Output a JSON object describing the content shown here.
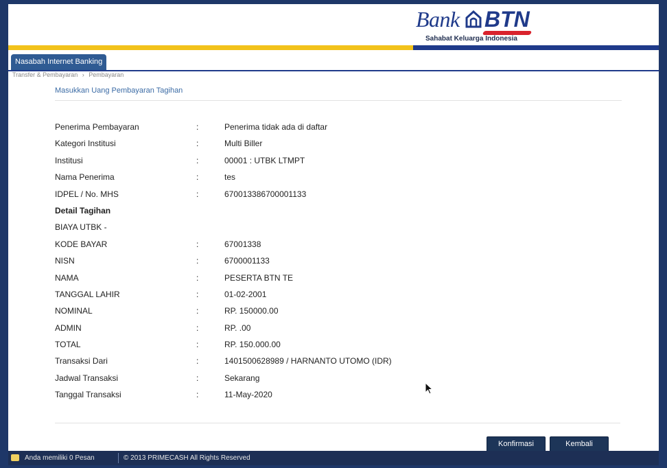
{
  "header": {
    "logo_bank": "Bank",
    "logo_btn": "BTN",
    "tagline": "Sahabat Keluarga Indonesia",
    "colors": {
      "brand_blue": "#1f3a8a",
      "accent_yellow": "#f2c21b",
      "accent_red": "#d9232d"
    }
  },
  "tabs": [
    {
      "label": "Nasabah Internet Banking"
    }
  ],
  "breadcrumb": [
    "Transfer & Pembayaran",
    "Pembayaran"
  ],
  "section_title": "Masukkan Uang Pembayaran Tagihan",
  "rows": [
    {
      "label": "Penerima Pembayaran",
      "colon": ":",
      "value": "Penerima tidak ada di daftar"
    },
    {
      "label": "Kategori Institusi",
      "colon": ":",
      "value": "Multi Biller"
    },
    {
      "label": "Institusi",
      "colon": ":",
      "value": "00001 : UTBK LTMPT"
    },
    {
      "label": "Nama Penerima",
      "colon": ":",
      "value": "tes"
    },
    {
      "label": "IDPEL / No. MHS",
      "colon": ":",
      "value": "670013386700001133"
    },
    {
      "label": "Detail Tagihan",
      "colon": "",
      "value": ""
    },
    {
      "label": "BIAYA UTBK -",
      "colon": "",
      "value": ""
    },
    {
      "label": "KODE BAYAR",
      "colon": ":",
      "value": "67001338"
    },
    {
      "label": "NISN",
      "colon": ":",
      "value": "6700001133"
    },
    {
      "label": "NAMA",
      "colon": ":",
      "value": "PESERTA BTN TE"
    },
    {
      "label": "TANGGAL LAHIR",
      "colon": ":",
      "value": "01-02-2001"
    },
    {
      "label": "NOMINAL",
      "colon": ":",
      "value": "RP. 150000.00"
    },
    {
      "label": "ADMIN",
      "colon": ":",
      "value": "RP. .00"
    },
    {
      "label": "TOTAL",
      "colon": ":",
      "value": "RP. 150.000.00"
    },
    {
      "label": "Transaksi Dari",
      "colon": ":",
      "value": "1401500628989 / HARNANTO UTOMO (IDR)"
    },
    {
      "label": "Jadwal Transaksi",
      "colon": ":",
      "value": "Sekarang"
    },
    {
      "label": "Tanggal Transaksi",
      "colon": ":",
      "value": "11-May-2020"
    }
  ],
  "buttons": {
    "confirm": "Konfirmasi",
    "back": "Kembali"
  },
  "footer": {
    "message": "Anda memiliki 0 Pesan",
    "copyright": "© 2013 PRIMECASH All Rights Reserved"
  }
}
